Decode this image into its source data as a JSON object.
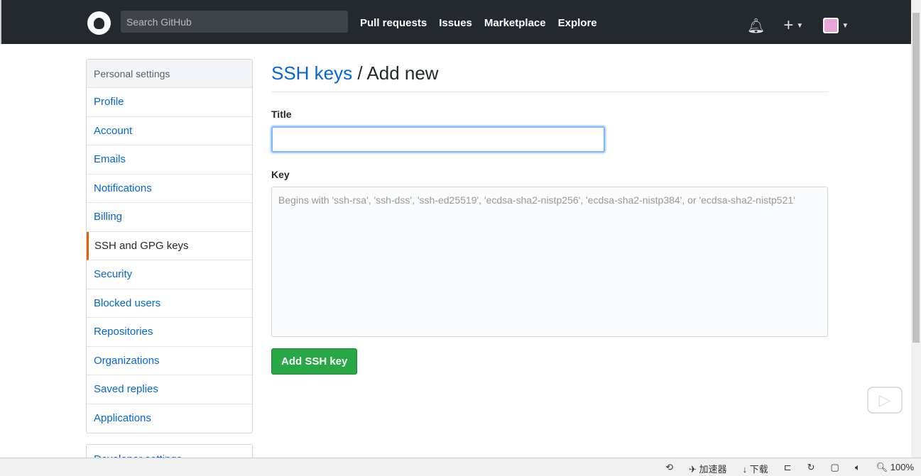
{
  "header": {
    "search_placeholder": "Search GitHub",
    "nav": [
      "Pull requests",
      "Issues",
      "Marketplace",
      "Explore"
    ],
    "icons": [
      "bell-icon",
      "plus-icon",
      "avatar"
    ]
  },
  "sidebar": {
    "heading": "Personal settings",
    "items": [
      "Profile",
      "Account",
      "Emails",
      "Notifications",
      "Billing",
      "SSH and GPG keys",
      "Security",
      "Blocked users",
      "Repositories",
      "Organizations",
      "Saved replies",
      "Applications"
    ],
    "selected": "SSH and GPG keys",
    "developer": "Developer settings"
  },
  "main": {
    "breadcrumb_link": "SSH keys",
    "breadcrumb_rest": " / Add new",
    "title_label": "Title",
    "title_value": "",
    "key_label": "Key",
    "key_placeholder": "Begins with 'ssh-rsa', 'ssh-dss', 'ssh-ed25519', 'ecdsa-sha2-nistp256', 'ecdsa-sha2-nistp384', or 'ecdsa-sha2-nistp521'",
    "submit": "Add SSH key"
  },
  "statusbar": {
    "accelerator": "加速器",
    "download": "下载",
    "zoom": "100%"
  },
  "colors": {
    "header": "#24292e",
    "link": "#0366d6",
    "button": "#28a745",
    "selected_accent": "#e36209"
  }
}
